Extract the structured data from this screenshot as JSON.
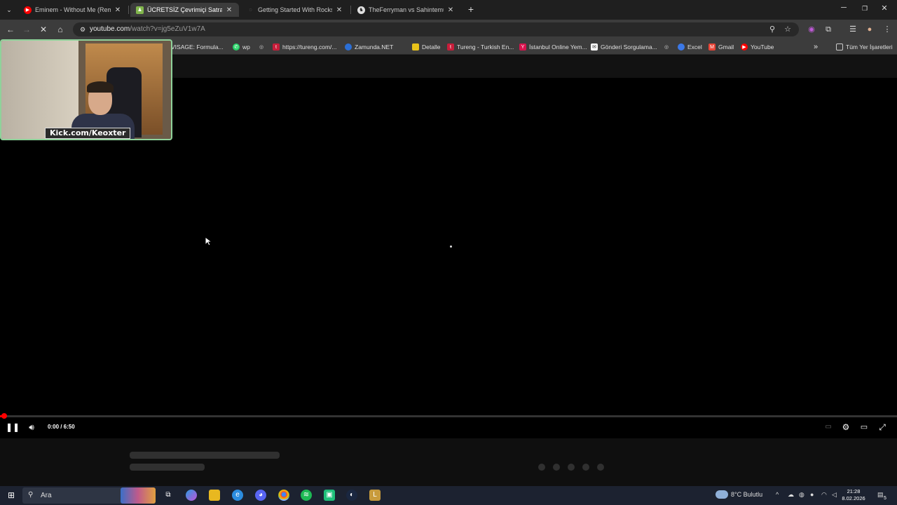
{
  "tabs": [
    {
      "title": "Eminem - Without Me (Remix) |",
      "favicon": "youtube-icon",
      "color": "#ff0000"
    },
    {
      "title": "ÜCRETSİZ Çevrimiçi Satranç Oy",
      "favicon": "chess-pawn-icon",
      "color": "#81b64c",
      "active": true
    },
    {
      "title": "Getting Started With Rocksmith",
      "favicon": "globe-icon",
      "color": "#777777"
    },
    {
      "title": "TheFerryman vs Sahintemur:",
      "favicon": "chess-icon",
      "color": "#dddddd"
    }
  ],
  "toolbar": {
    "url_host": "youtube.com",
    "url_path": "/watch?v=jg5eZuV1w7A"
  },
  "bookmarks": [
    {
      "label": "VISAGE: Formula...",
      "icon": "visage-icon",
      "color": "#444"
    },
    {
      "label": "wp",
      "icon": "whatsapp-icon",
      "color": "#25d366"
    },
    {
      "label": "",
      "icon": "globe-icon",
      "color": "#666"
    },
    {
      "label": "https://tureng.com/...",
      "icon": "tureng-icon",
      "color": "#c81d3a"
    },
    {
      "label": "Zamunda.NET",
      "icon": "zamunda-icon",
      "color": "#2b6fd6"
    },
    {
      "label": "Detalle",
      "icon": "detalle-icon",
      "color": "#e8c21a"
    },
    {
      "label": "Tureng - Turkish En...",
      "icon": "tureng-icon",
      "color": "#c81d3a"
    },
    {
      "label": "İstanbul Online Yem...",
      "icon": "yemeksepeti-icon",
      "color": "#d8134d"
    },
    {
      "label": "Gönderi Sorgulama...",
      "icon": "ptt-icon",
      "color": "#ffffff"
    },
    {
      "label": "",
      "icon": "globe-icon",
      "color": "#666"
    },
    {
      "label": "Excel",
      "icon": "excel-globe-icon",
      "color": "#3b78e7"
    },
    {
      "label": "Gmail",
      "icon": "gmail-icon",
      "color": "#ea4335"
    },
    {
      "label": "YouTube",
      "icon": "youtube-icon",
      "color": "#ff0000"
    }
  ],
  "bookmarks_all_label": "Tüm Yer İşaretleri",
  "webcam": {
    "label": "Kick.com/Keoxter"
  },
  "player": {
    "time": "0:00 / 6:50",
    "progress_fraction": 0.005
  },
  "taskbar": {
    "search_placeholder": "Ara",
    "weather": "8°C  Bulutlu",
    "time": "21:28",
    "date": "8.02.2026",
    "notifications": "5"
  }
}
